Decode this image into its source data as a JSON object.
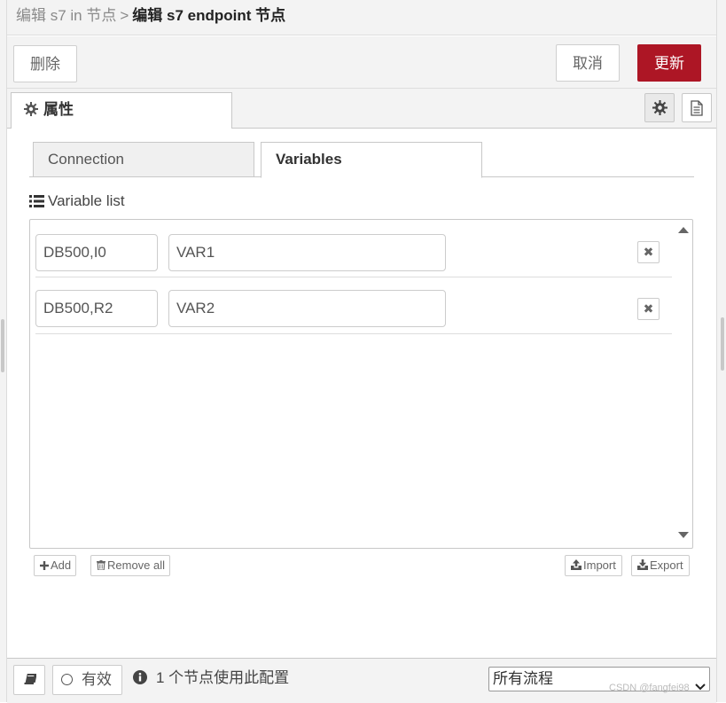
{
  "breadcrumb": {
    "previous": "编辑 s7 in 节点",
    "separator": ">",
    "current": "编辑 s7 endpoint 节点"
  },
  "toolbar": {
    "delete_label": "删除",
    "cancel_label": "取消",
    "update_label": "更新"
  },
  "tabs": {
    "properties_label": "属性"
  },
  "subtabs": {
    "connection": "Connection",
    "variables": "Variables"
  },
  "variable_list": {
    "label": "Variable list",
    "rows": [
      {
        "address": "DB500,I0",
        "name": "VAR1"
      },
      {
        "address": "DB500,R2",
        "name": "VAR2"
      }
    ],
    "add_label": "Add",
    "remove_all_label": "Remove all",
    "import_label": "Import",
    "export_label": "Export"
  },
  "footer": {
    "enabled_label": "有效",
    "usage_text": "1 个节点使用此配置",
    "scope_value": "所有流程",
    "watermark": "CSDN @fangfei98"
  },
  "colors": {
    "update_button": "#ad1625",
    "panel_background": "#f3f3f3"
  },
  "icons": [
    "gear-icon",
    "document-icon",
    "list-icon",
    "plus-icon",
    "trash-icon",
    "upload-icon",
    "download-icon",
    "book-icon",
    "info-icon",
    "chevron-down-icon",
    "remove-x-icon"
  ]
}
